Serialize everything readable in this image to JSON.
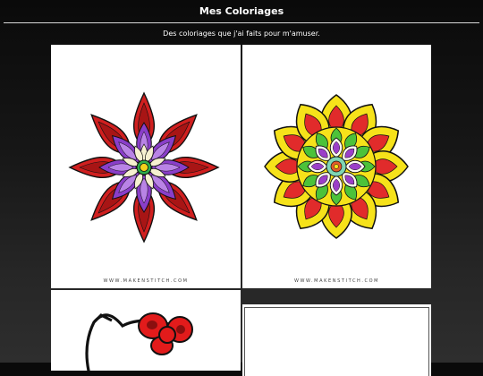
{
  "header": {
    "title": "Mes Coloriages",
    "subtitle": "Des coloriages que j'ai faits pour m'amuser."
  },
  "gallery": {
    "items": [
      {
        "credit": "WWW.MAKENSTITCH.COM"
      },
      {
        "credit": "WWW.MAKENSTITCH.COM"
      },
      {
        "credit": ""
      },
      {
        "credit": ""
      }
    ]
  },
  "colors": {
    "background": "#1a1a1a",
    "text": "#ffffff",
    "card": "#ffffff"
  }
}
